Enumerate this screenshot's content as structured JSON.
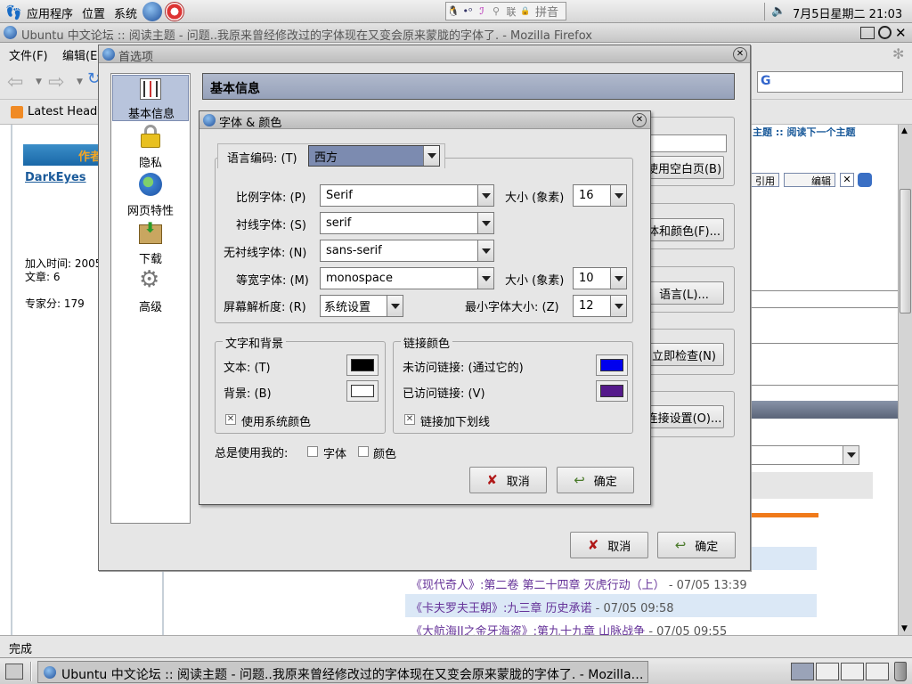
{
  "panel": {
    "apps": "应用程序",
    "places": "位置",
    "system": "系统",
    "ime_items": [
      "🐧",
      "•ᵒ",
      "ℐ",
      "⚲",
      "联",
      "🔒",
      "拼音"
    ],
    "clock": "7月5日星期二 21:03"
  },
  "firefox": {
    "title": "Ubuntu 中文论坛 :: 阅读主题 - 问题..我原来曾经修改过的字体现在又变会原来蒙胧的字体了. - Mozilla Firefox",
    "menu": {
      "file": "文件(F)",
      "edit": "编辑(E"
    },
    "bookmark": "Latest Headl",
    "status": "完成"
  },
  "forum": {
    "author_header": "作者",
    "author": "DarkEyes",
    "joined": "加入时间: 2005",
    "posts": "文章: 6",
    "expert": "专家分: 179",
    "topic_nav": "主题 :: 阅读下一个主题",
    "quote": "引用",
    "edit": "编辑",
    "links": [
      {
        "title": "《现代奇人》",
        "rest": ":第二卷 第二十四章 灭虎行动（上）",
        "date": "- 07/05 13:39"
      },
      {
        "title": "《卡夫罗夫王朝》",
        "rest": ":九三章 历史承诺",
        "date": "- 07/05 09:58"
      },
      {
        "title": "《大航海II之金牙海盗》",
        "rest": ":第九十九章 山脉战争",
        "date": "- 07/05 09:55"
      }
    ]
  },
  "prefs": {
    "title": "首选项",
    "header": "基本信息",
    "categories": [
      "基本信息",
      "隐私",
      "网页特性",
      "下载",
      "高级"
    ],
    "right_buttons": [
      "使用空白页(B)",
      "体和颜色(F)...",
      "语言(L)...",
      "立即检查(N)",
      "连接设置(O)..."
    ],
    "cancel": "取消",
    "ok": "确定"
  },
  "fonts": {
    "title": "字体 & 颜色",
    "encoding_label": "语言编码: (T)",
    "encoding_value": "西方",
    "prop_label": "比例字体: (P)",
    "prop_value": "Serif",
    "size_label": "大小 (象素)",
    "prop_size": "16",
    "serif_label": "衬线字体: (S)",
    "serif_value": "serif",
    "sans_label": "无衬线字体: (N)",
    "sans_value": "sans-serif",
    "mono_label": "等宽字体: (M)",
    "mono_value": "monospace",
    "mono_size": "10",
    "res_label": "屏幕解析度: (R)",
    "res_value": "系统设置",
    "min_label": "最小字体大小: (Z)",
    "min_value": "12",
    "text_bg_group": "文字和背景",
    "text_label": "文本: (T)",
    "bg_label": "背景: (B)",
    "system_colors": "使用系统颜色",
    "link_group": "链接颜色",
    "unvisited_label": "未访问链接: (通过它的)",
    "visited_label": "已访问链接: (V)",
    "underline": "链接加下划线",
    "always_use": "总是使用我的:",
    "font_cb": "字体",
    "color_cb": "颜色",
    "cancel": "取消",
    "ok": "确定",
    "colors": {
      "text": "#000000",
      "bg": "#ffffff",
      "unvisited": "#0000ee",
      "visited": "#551a8b"
    }
  },
  "taskbar": {
    "task": "Ubuntu 中文论坛 :: 阅读主题 - 问题..我原来曾经修改过的字体现在又变会原来蒙胧的字体了. - Mozilla Firefox"
  }
}
